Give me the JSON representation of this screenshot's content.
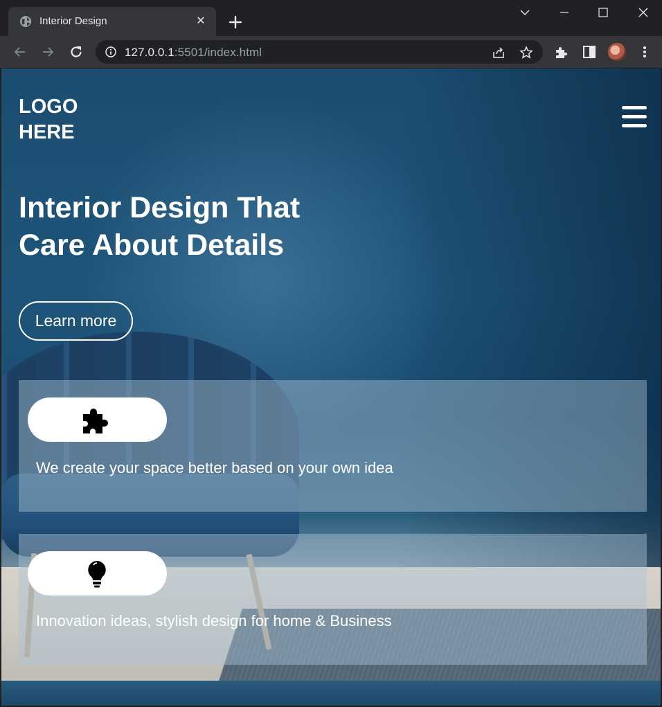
{
  "browser": {
    "tab_title": "Interior Design",
    "url_host": "127.0.0.1",
    "url_rest": ":5501/index.html"
  },
  "page": {
    "logo": "LOGO HERE",
    "hero_title": "Interior Design That Care About Details",
    "cta_label": "Learn more",
    "features": [
      {
        "icon": "puzzle-icon",
        "text": "We create your space better based on your own idea"
      },
      {
        "icon": "lightbulb-icon",
        "text": "Innovation ideas, stylish design for home & Business"
      }
    ]
  },
  "colors": {
    "chrome_dark": "#202124",
    "chrome_toolbar": "#35363a",
    "hero_blue": "#1f557a",
    "text_white": "#ffffff"
  }
}
